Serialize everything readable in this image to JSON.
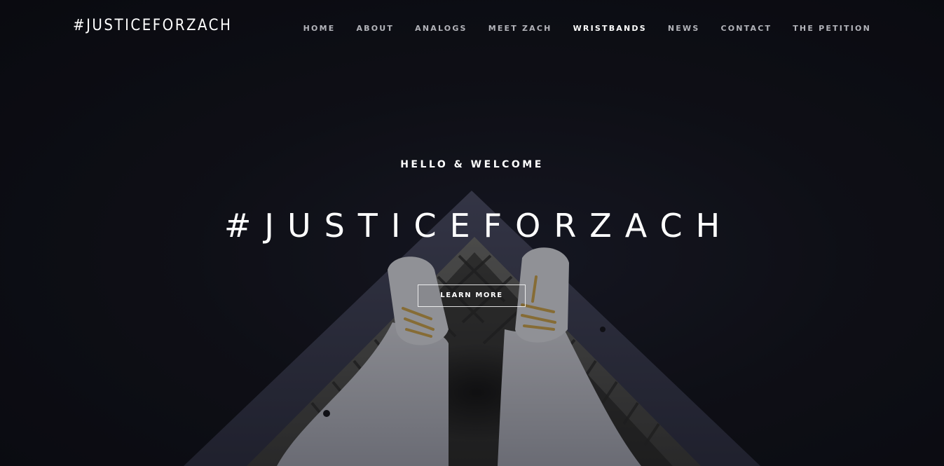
{
  "brand": {
    "title": "#JUSTICEFORZACH"
  },
  "nav": {
    "items": [
      {
        "label": "HOME",
        "active": false
      },
      {
        "label": "ABOUT",
        "active": false
      },
      {
        "label": "ANALOGS",
        "active": false
      },
      {
        "label": "MEET ZACH",
        "active": false
      },
      {
        "label": "WRISTBANDS",
        "active": true
      },
      {
        "label": "NEWS",
        "active": false
      },
      {
        "label": "CONTACT",
        "active": false
      },
      {
        "label": "THE PETITION",
        "active": false
      }
    ]
  },
  "hero": {
    "tagline": "HELLO & WELCOME",
    "title": "#JUSTICEFORZACH",
    "cta_label": "LEARN MORE",
    "background_image": "person-standing-on-edge-of-dock-photo"
  },
  "colors": {
    "background": "#0d0e14",
    "text": "#ffffff",
    "nav_text": "#b3b4ba",
    "nav_active": "#ffffff",
    "shoelace_accent": "#c9a24a"
  }
}
